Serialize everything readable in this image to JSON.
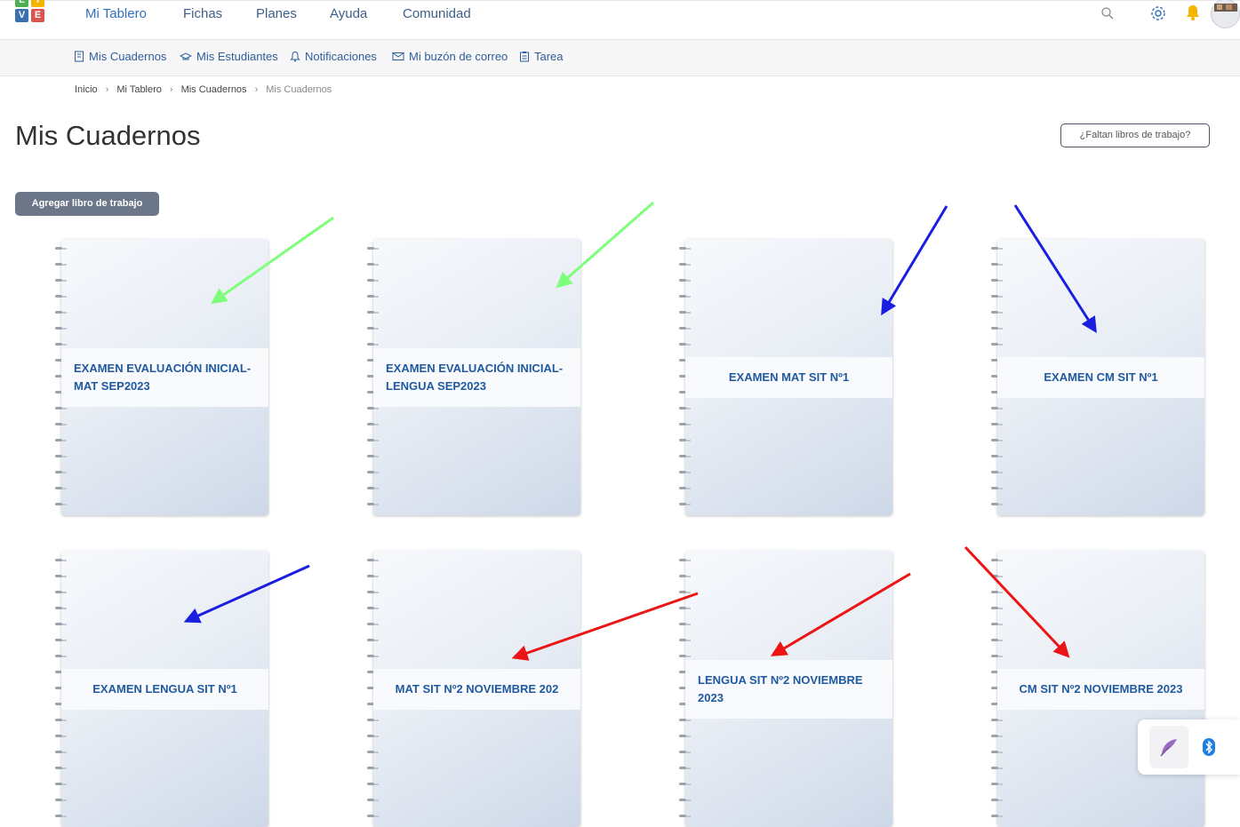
{
  "logo": {
    "letters": [
      "L",
      "I",
      "V",
      "E"
    ],
    "colors": [
      "#4caf50",
      "#f5b400",
      "#3a6fb0",
      "#d9534f"
    ]
  },
  "nav": {
    "items": [
      "Mi Tablero",
      "Fichas",
      "Planes",
      "Ayuda",
      "Comunidad"
    ]
  },
  "subnav": {
    "items": [
      "Mis Cuadernos",
      "Mis Estudiantes",
      "Notificaciones",
      "Mi buzón de correo",
      "Tarea"
    ]
  },
  "breadcrumb": [
    "Inicio",
    "Mi Tablero",
    "Mis Cuadernos",
    "Mis Cuadernos"
  ],
  "page": {
    "title": "Mis Cuadernos",
    "missing_button": "¿Faltan libros de trabajo?",
    "add_button": "Agregar libro de trabajo"
  },
  "notebooks": [
    {
      "title": "EXAMEN EVALUACIÓN INICIAL-\nMAT SEP2023"
    },
    {
      "title": "EXAMEN EVALUACIÓN INICIAL-\nLENGUA SEP2023"
    },
    {
      "title": "EXAMEN MAT SIT Nº1"
    },
    {
      "title": "EXAMEN CM SIT Nº1"
    },
    {
      "title": "EXAMEN LENGUA SIT Nº1"
    },
    {
      "title": "MAT SIT Nº2 NOVIEMBRE 202"
    },
    {
      "title": "LENGUA SIT Nº2 NOVIEMBRE\n2023"
    },
    {
      "title": "CM SIT Nº2 NOVIEMBRE 2023"
    }
  ],
  "annotation_colors": {
    "green": "#7dff7a",
    "blue": "#1a1ee0",
    "red": "#ec1414"
  },
  "icons": {
    "search": "search-icon",
    "settings": "gear-icon",
    "notifications": "bell-icon",
    "avatar": "avatar",
    "feather": "feather-icon",
    "bluetooth": "bluetooth-icon"
  }
}
